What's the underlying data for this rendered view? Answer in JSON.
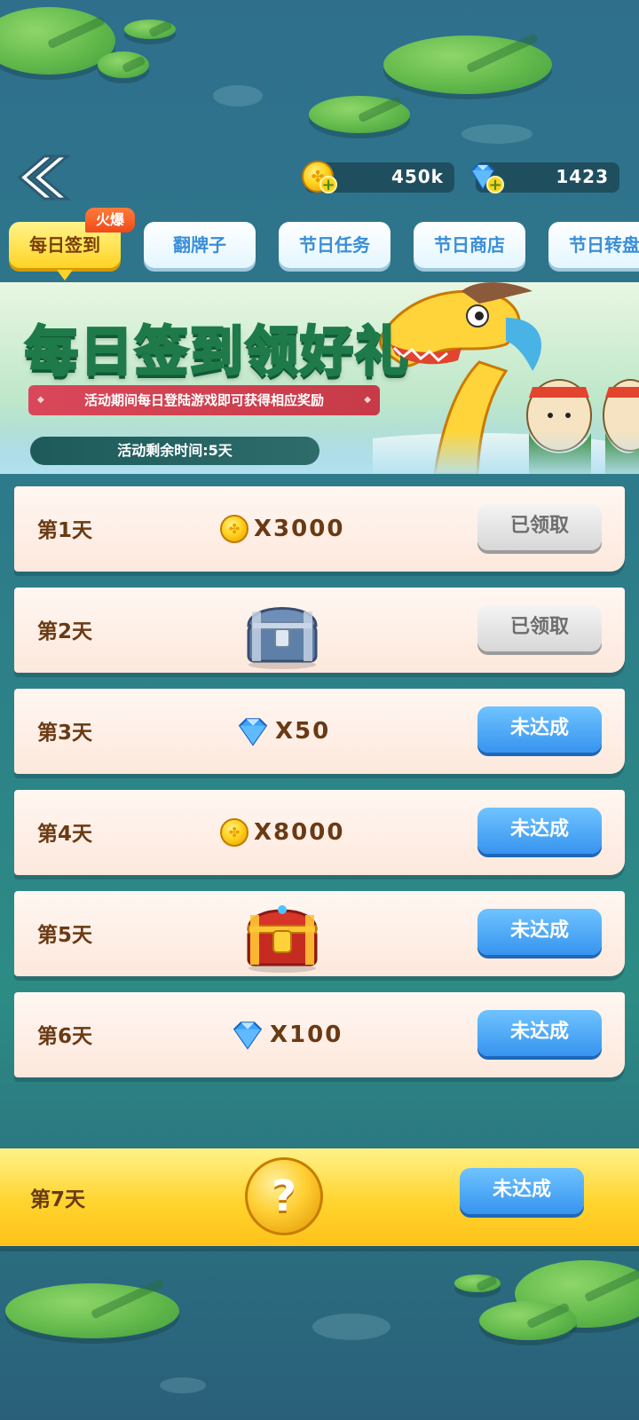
{
  "header": {
    "coins": "450k",
    "gems": "1423"
  },
  "tabs": [
    {
      "label": "每日签到",
      "active": true
    },
    {
      "label": "翻牌子",
      "active": false
    },
    {
      "label": "节日任务",
      "active": false
    },
    {
      "label": "节日商店",
      "active": false
    },
    {
      "label": "节日转盘",
      "active": false
    }
  ],
  "hot_badge": "火爆",
  "banner": {
    "title": "每日签到领好礼",
    "subtitle": "活动期间每日登陆游戏即可获得相应奖励",
    "timer": "活动剩余时间:5天"
  },
  "days": [
    {
      "label": "第1天",
      "reward_icon": "coin-icon",
      "amount": "X3000",
      "button": "已领取",
      "status": "claimed"
    },
    {
      "label": "第2天",
      "reward_icon": "silver-chest-icon",
      "amount": "",
      "button": "已领取",
      "status": "claimed"
    },
    {
      "label": "第3天",
      "reward_icon": "gem-icon",
      "amount": "X50",
      "button": "未达成",
      "status": "pending"
    },
    {
      "label": "第4天",
      "reward_icon": "coin-icon",
      "amount": "X8000",
      "button": "未达成",
      "status": "pending"
    },
    {
      "label": "第5天",
      "reward_icon": "red-gold-chest-icon",
      "amount": "",
      "button": "未达成",
      "status": "pending"
    },
    {
      "label": "第6天",
      "reward_icon": "gem-icon",
      "amount": "X100",
      "button": "未达成",
      "status": "pending"
    }
  ],
  "day7": {
    "label": "第7天",
    "reward_icon": "mystery-coin-icon",
    "mystery_symbol": "?",
    "button": "未达成"
  },
  "colors": {
    "claimed_button": "#d7d7d7",
    "pending_button": "#3794ef",
    "active_tab": "#ffd325",
    "day7_bar": "#ffd42e"
  }
}
